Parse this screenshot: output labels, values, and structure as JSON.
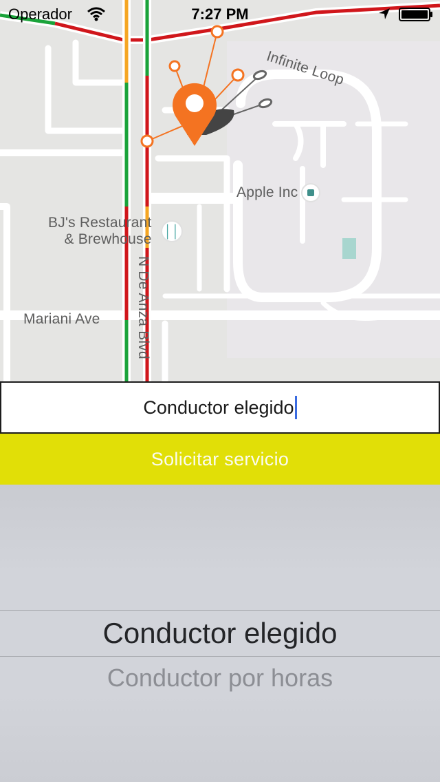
{
  "status_bar": {
    "carrier": "Operador",
    "time": "7:27 PM",
    "icons": [
      "wifi-icon",
      "location-arrow-icon",
      "battery-icon"
    ]
  },
  "map": {
    "labels": {
      "apple": "Apple Inc",
      "bjs_line1": "BJ's Restaurant",
      "bjs_line2": "& Brewhouse",
      "mariani": "Mariani Ave",
      "de_anza": "N De Anza Blvd",
      "infinite_loop": "Infinite Loop"
    },
    "pin_color": "#f47321",
    "traffic_colors": {
      "green": "#1aa33a",
      "orange": "#f5a623",
      "red": "#d0161b"
    }
  },
  "input": {
    "value": "Conductor elegido"
  },
  "button": {
    "label": "Solicitar servicio",
    "color": "#e1df07"
  },
  "picker": {
    "selected": "Conductor elegido",
    "next": "Conductor por horas"
  }
}
